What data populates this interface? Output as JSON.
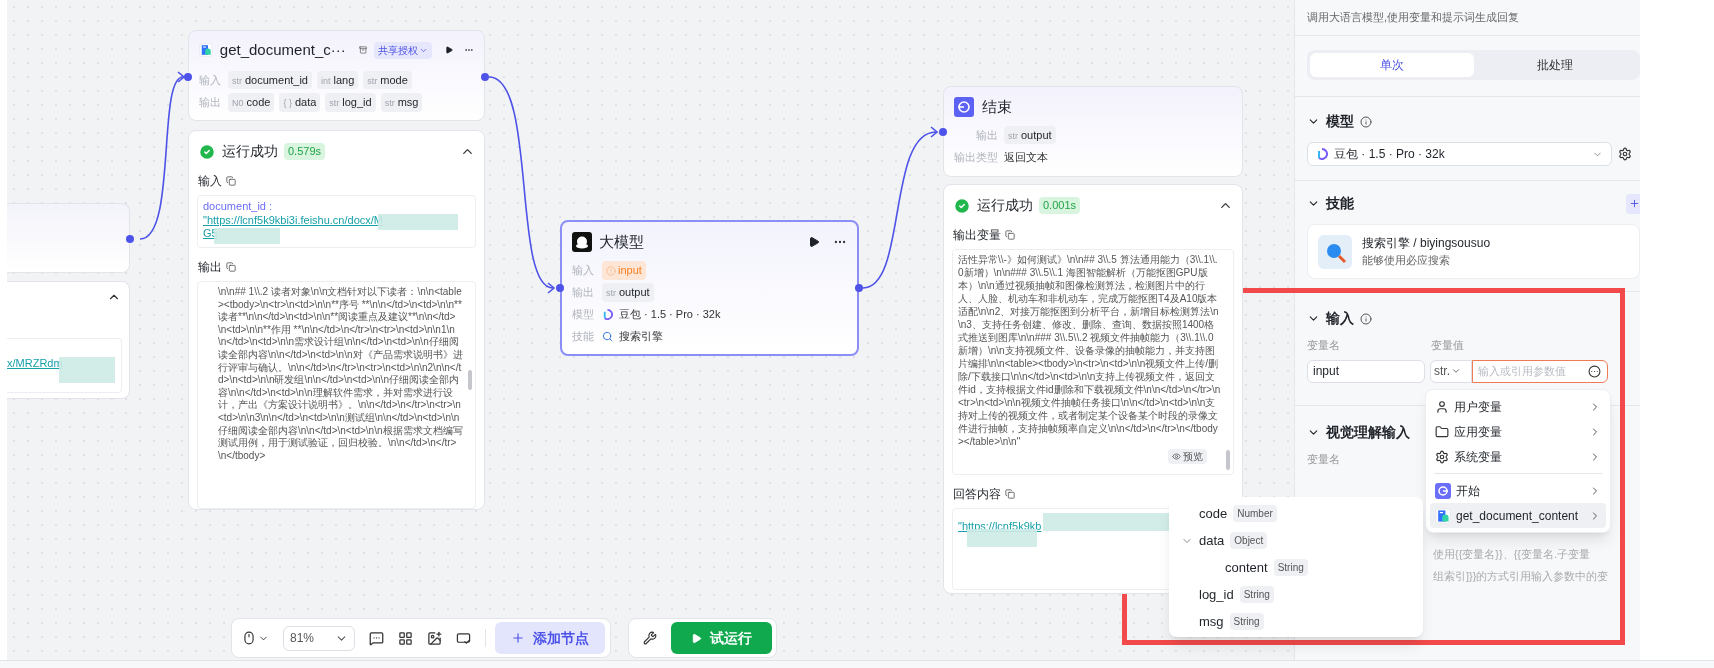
{
  "left_node": {
    "link": "x/MRZRdm",
    "expanded": true
  },
  "doc_node": {
    "title": "get_document_c···",
    "badge": "共享授权",
    "input_label": "输入",
    "output_label": "输出",
    "inputs": [
      {
        "type": "str",
        "name": "document_id"
      },
      {
        "type": "int",
        "name": "lang"
      },
      {
        "type": "str",
        "name": "mode"
      }
    ],
    "outputs": [
      {
        "type": "N0",
        "name": "code"
      },
      {
        "type": "{ }",
        "name": "data"
      },
      {
        "type": "str",
        "name": "log_id"
      },
      {
        "type": "str",
        "name": "msg"
      }
    ],
    "run": {
      "status": "运行成功",
      "time": "0.579s",
      "expanded": true,
      "input_title": "输入",
      "input_key": "document_id :",
      "input_link": "\"https://lcnf5k9kbi3i.feishu.cn/docx/M",
      "input_link_tail": "G5",
      "output_title": "输出",
      "output_text": "\\n\\n## 1\\\\.2 读者对象\\n\\n文档针对以下读者：\\n\\n<table><tbody>\\n<tr>\\n<td>\\n\\n**序号 **\\n\\n</td>\\n<td>\\n\\n**读者**\\n\\n</td>\\n<td>\\n\\n**阅读重点及建议**\\n\\n</td>\\n<td>\\n\\n**作用 **\\n\\n</td>\\n</tr>\\n<tr>\\n<td>\\n\\n1\\n\\n</td>\\n<td>\\n\\n需求设计组\\n\\n</td>\\n<td>\\n\\n仔细阅读全部内容\\n\\n</td>\\n<td>\\n\\n对《产品需求说明书》进行评审与确认。\\n\\n</td>\\n</tr>\\n<tr>\\n<td>\\n\\n2\\n\\n</td>\\n<td>\\n\\n研发组\\n\\n</td>\\n<td>\\n\\n仔细阅读全部内容\\n\\n</td>\\n<td>\\n\\n理解软件需求，并对需求进行设计，产出《方案设计说明书》。\\n\\n</td>\\n</tr>\\n<tr>\\n<td>\\n\\n3\\n\\n</td>\\n<td>\\n\\n测试组\\n\\n</td>\\n<td>\\n\\n仔细阅读全部内容\\n\\n</td>\\n<td>\\n\\n根据需求文档编写测试用例，用于测试验证，回归校验。\\n\\n</td>\\n</tr>\\n</tbody>"
    }
  },
  "llm_node": {
    "title": "大模型",
    "rows": [
      {
        "label": "输入",
        "kind": "warning",
        "value": "input"
      },
      {
        "label": "输出",
        "kind": "chip",
        "type": "str",
        "value": "output"
      },
      {
        "label": "模型",
        "kind": "model",
        "value": "豆包 · 1.5 · Pro · 32k"
      },
      {
        "label": "技能",
        "kind": "skill",
        "value": "搜索引擎"
      }
    ]
  },
  "end_node": {
    "title": "结束",
    "output_label": "输出",
    "output_type": "str",
    "output_name": "output",
    "type_label": "输出类型",
    "type_value": "返回文本",
    "run": {
      "status": "运行成功",
      "time": "0.001s",
      "expanded": true,
      "output_title": "输出变量",
      "output_text": "活性异常\\\\-》如何测试》\\n\\n## 3\\\\.5 算法通用能力（3\\\\.1\\\\.0新增）\\n\\n### 3\\\\.5\\\\.1 海图智能解析（万能抠图GPU版本）\\n\\n通过视频抽帧和图像检测算法，检测图片中的行人、人脸、机动车和非机动车，完成万能抠图T4及A10版本适配\\n\\n2、对接万能抠图到分析平台，新增目标检测算法\\n\\n3、支持任务创建、修改、删除、查询、数据按照1400格式推送到图库\\n\\n### 3\\\\.5\\\\.2 视频文件抽帧能力（3\\\\.1\\\\.0新增）\\n\\n支持视频文件、设备录像的抽帧能力，并支持图片编排\\n\\n<table><tbody>\\n<tr>\\n<td>\\n\\n视频文件上传/删除/下载接口\\n\\n</td>\\n<td>\\n\\n支持上传视频文件，返回文件id，支持根据文件id删除和下载视频文件\\n\\n</td>\\n</tr>\\n<tr>\\n<td>\\n\\n视频文件抽帧任务接口\\n\\n</td>\\n<td>\\n\\n支持对上传的视频文件，或者制定某个设备某个时段的录像文件进行抽帧，支持抽帧频率自定义\\n\\n</td>\\n</tr>\\n</tbody></table>\\n\\n\"",
      "preview": "预览",
      "answer_title": "回答内容",
      "answer_link": "\"https://lcnf5k9kb"
    }
  },
  "panel": {
    "description": "调用大语言模型,使用变量和提示词生成回复",
    "tabs": [
      {
        "label": "单次",
        "selected": true
      },
      {
        "label": "批处理",
        "selected": false
      }
    ],
    "model_title": "模型",
    "model_value": "豆包 · 1.5 · Pro · 32k",
    "skills_title": "技能",
    "skill": {
      "name": "搜索引擎 / biyingsousuo",
      "description": "能够使用必应搜索"
    },
    "input_title": "输入",
    "col_name": "变量名",
    "col_value": "变量值",
    "input_row": {
      "name": "input",
      "type": "str.",
      "placeholder": "输入或引用参数值"
    },
    "vision_title": "视觉理解输入",
    "vision_col": "变量名",
    "hint_lines": [
      "使用{{变量名}}、{{变量名.子变量",
      "组索引]}}的方式引用输入参数中的变"
    ]
  },
  "menu": [
    {
      "kind": "user",
      "label": "用户变量",
      "selected": false
    },
    {
      "kind": "folder",
      "label": "应用变量",
      "selected": false
    },
    {
      "kind": "gear",
      "label": "系统变量",
      "selected": false
    },
    {
      "kind": "start",
      "label": "开始",
      "selected": false
    },
    {
      "kind": "doc",
      "label": "get_document_content",
      "selected": true
    }
  ],
  "submenu": [
    {
      "name": "code",
      "type": "Number"
    },
    {
      "name": "data",
      "type": "Object",
      "expanded": true,
      "children": [
        {
          "name": "content",
          "type": "String"
        }
      ]
    },
    {
      "name": "log_id",
      "type": "String"
    },
    {
      "name": "msg",
      "type": "String"
    }
  ],
  "toolbar": {
    "zoom": "81%",
    "add_node": "添加节点",
    "test_run": "试运行"
  }
}
